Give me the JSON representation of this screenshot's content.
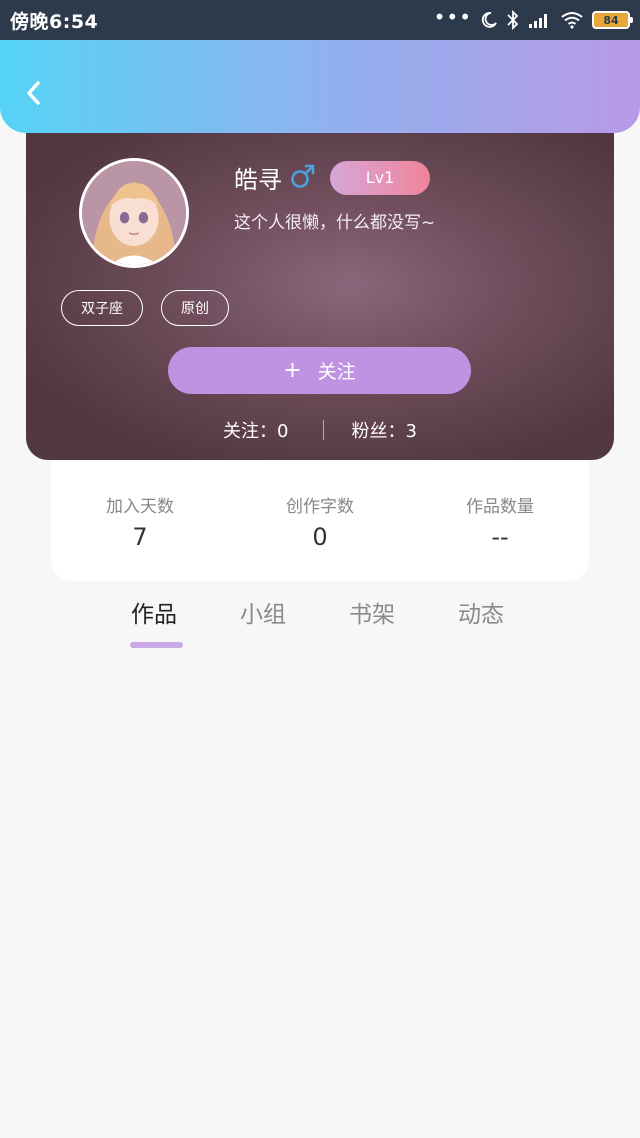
{
  "status_bar": {
    "time": "傍晚6:54",
    "dots": "•••",
    "battery": "84"
  },
  "header": {
    "back_icon": "chevron-left-icon"
  },
  "profile": {
    "username": "皓寻",
    "gender_icon": "male-icon",
    "level": "Lv1",
    "bio": "这个人很懒，什么都没写~",
    "tags": [
      "双子座",
      "原创"
    ],
    "follow_button": {
      "plus": "+",
      "label": "关注"
    },
    "following": "关注：0",
    "followers": "粉丝：3"
  },
  "stats": [
    {
      "label": "加入天数",
      "value": "7"
    },
    {
      "label": "创作字数",
      "value": "0"
    },
    {
      "label": "作品数量",
      "value": "--"
    }
  ],
  "tabs": {
    "items": [
      "作品",
      "小组",
      "书架",
      "动态"
    ],
    "active": "作品"
  },
  "colors": {
    "header_gradient_start": "#55d3f6",
    "header_gradient_end": "#b899e8",
    "accent": "#c093e2",
    "level_badge_start": "#d7a6d8",
    "level_badge_end": "#f0849a",
    "gender_male": "#4aa3e0",
    "tab_indicator": "#c9a9e6"
  }
}
